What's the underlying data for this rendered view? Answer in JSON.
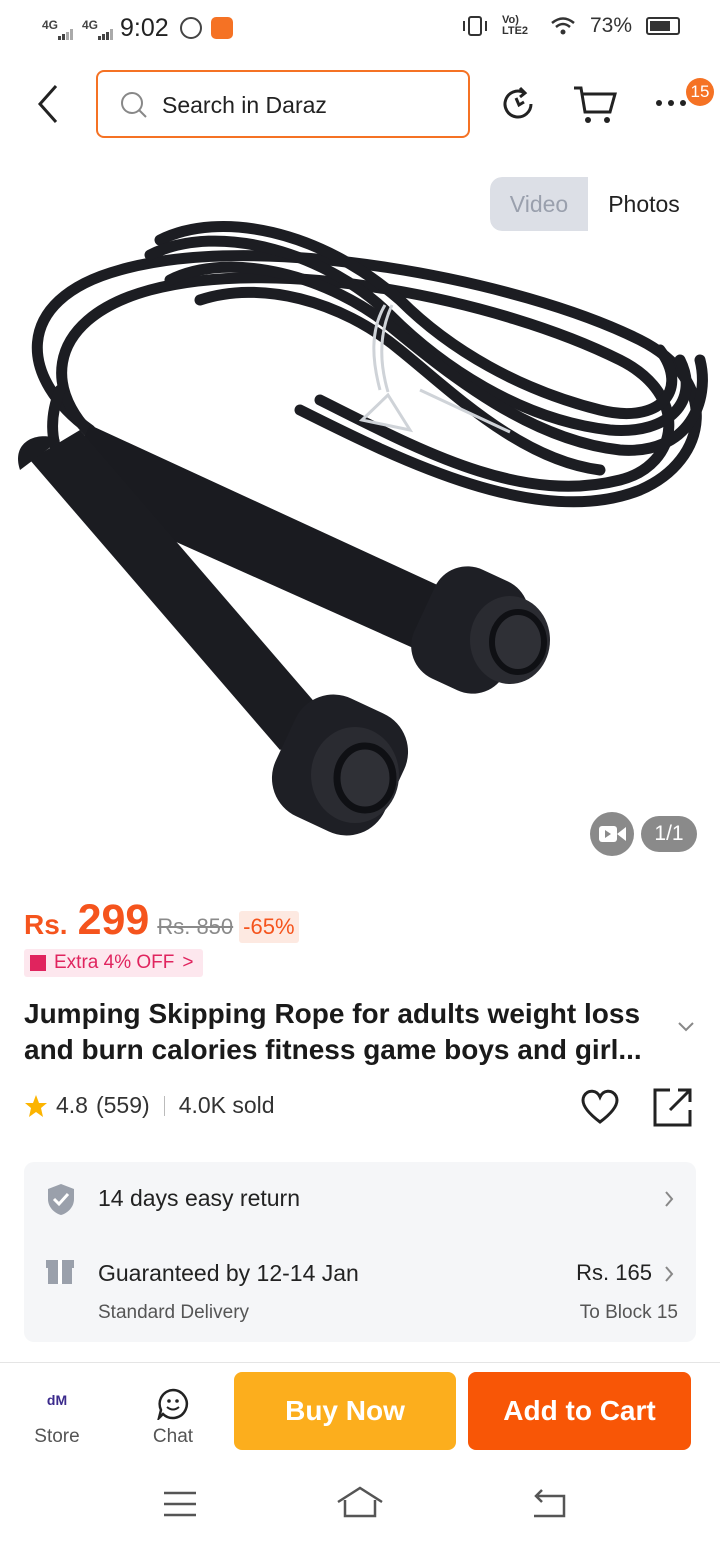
{
  "status_bar": {
    "net1": "4G",
    "net2": "4G",
    "time": "9:02",
    "volte": "Vo) LTE2",
    "battery": "73%"
  },
  "header": {
    "search_placeholder": "Search in Daraz",
    "cart_badge": "15"
  },
  "gallery": {
    "tab_video": "Video",
    "tab_photos": "Photos",
    "counter": "1/1"
  },
  "price": {
    "currency": "Rs.",
    "current": "299",
    "original": "Rs. 850",
    "discount": "-65%",
    "voucher": "Extra 4% OFF",
    "voucher_chevron": ">"
  },
  "product": {
    "title": "Jumping Skipping Rope for adults weight loss and burn calories fitness game boys and girl...",
    "rating": "4.8",
    "reviews": "(559)",
    "sold": "4.0K sold"
  },
  "service": {
    "returns": "14 days easy return",
    "delivery_title": "Guaranteed by 12-14 Jan",
    "delivery_type": "Standard Delivery",
    "delivery_fee": "Rs. 165",
    "delivery_location": "To Block 15"
  },
  "actions": {
    "store_logo": "dM",
    "store": "Store",
    "chat": "Chat",
    "buy_now": "Buy Now",
    "add_to_cart": "Add to Cart"
  },
  "colors": {
    "brand": "#f57224",
    "price": "#f5541d",
    "buy_now": "#fcae1d",
    "add_to_cart": "#f85606"
  }
}
